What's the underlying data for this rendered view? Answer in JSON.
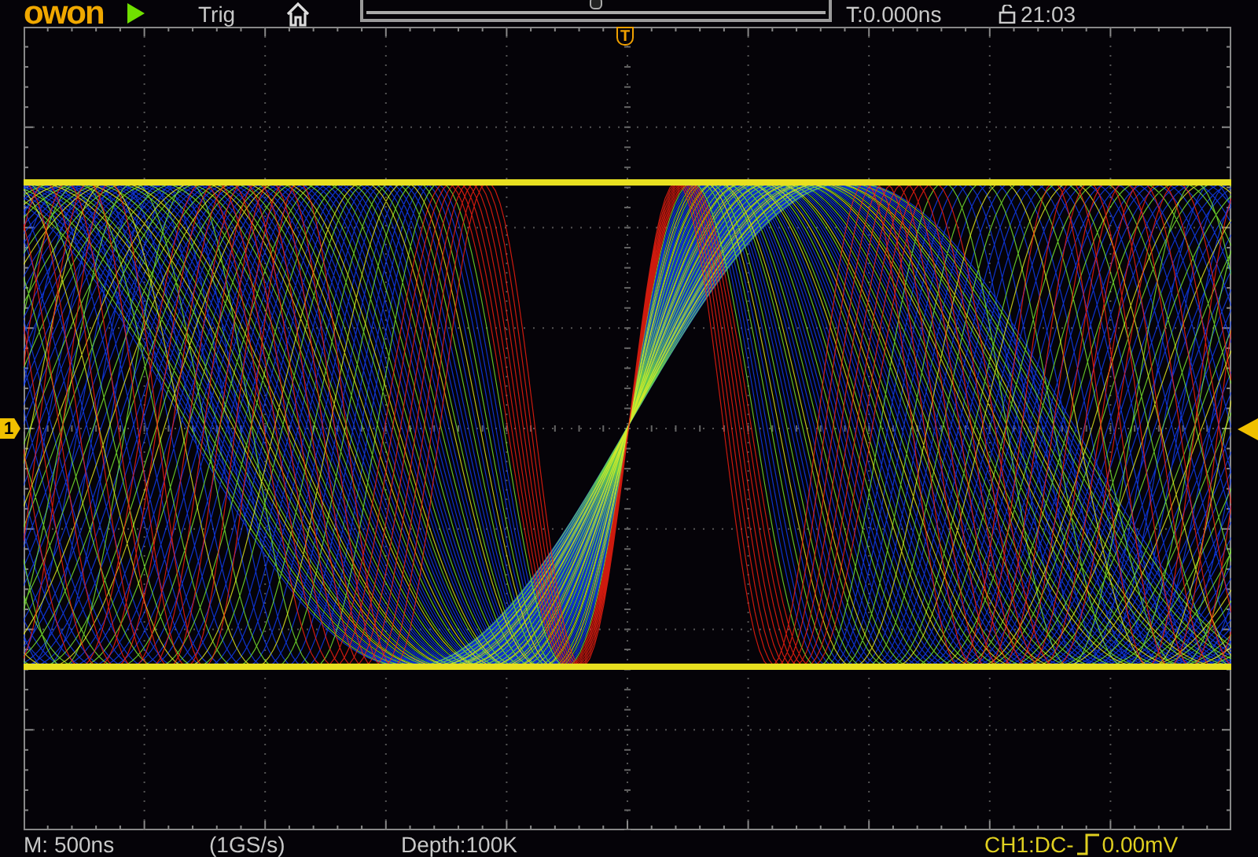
{
  "top_bar": {
    "logo": "owon",
    "running": true,
    "trigger_label": "Trig",
    "time_offset": "T:0.000ns",
    "clock": "21:03"
  },
  "screen": {
    "trigger_marker": "T",
    "channel_marker": "1"
  },
  "bottom_bar": {
    "timebase": "M: 500ns",
    "sample_rate": "(1GS/s)",
    "depth": "Depth:100K",
    "channel": "CH1:DC-",
    "trigger_level": "0.00mV"
  }
}
